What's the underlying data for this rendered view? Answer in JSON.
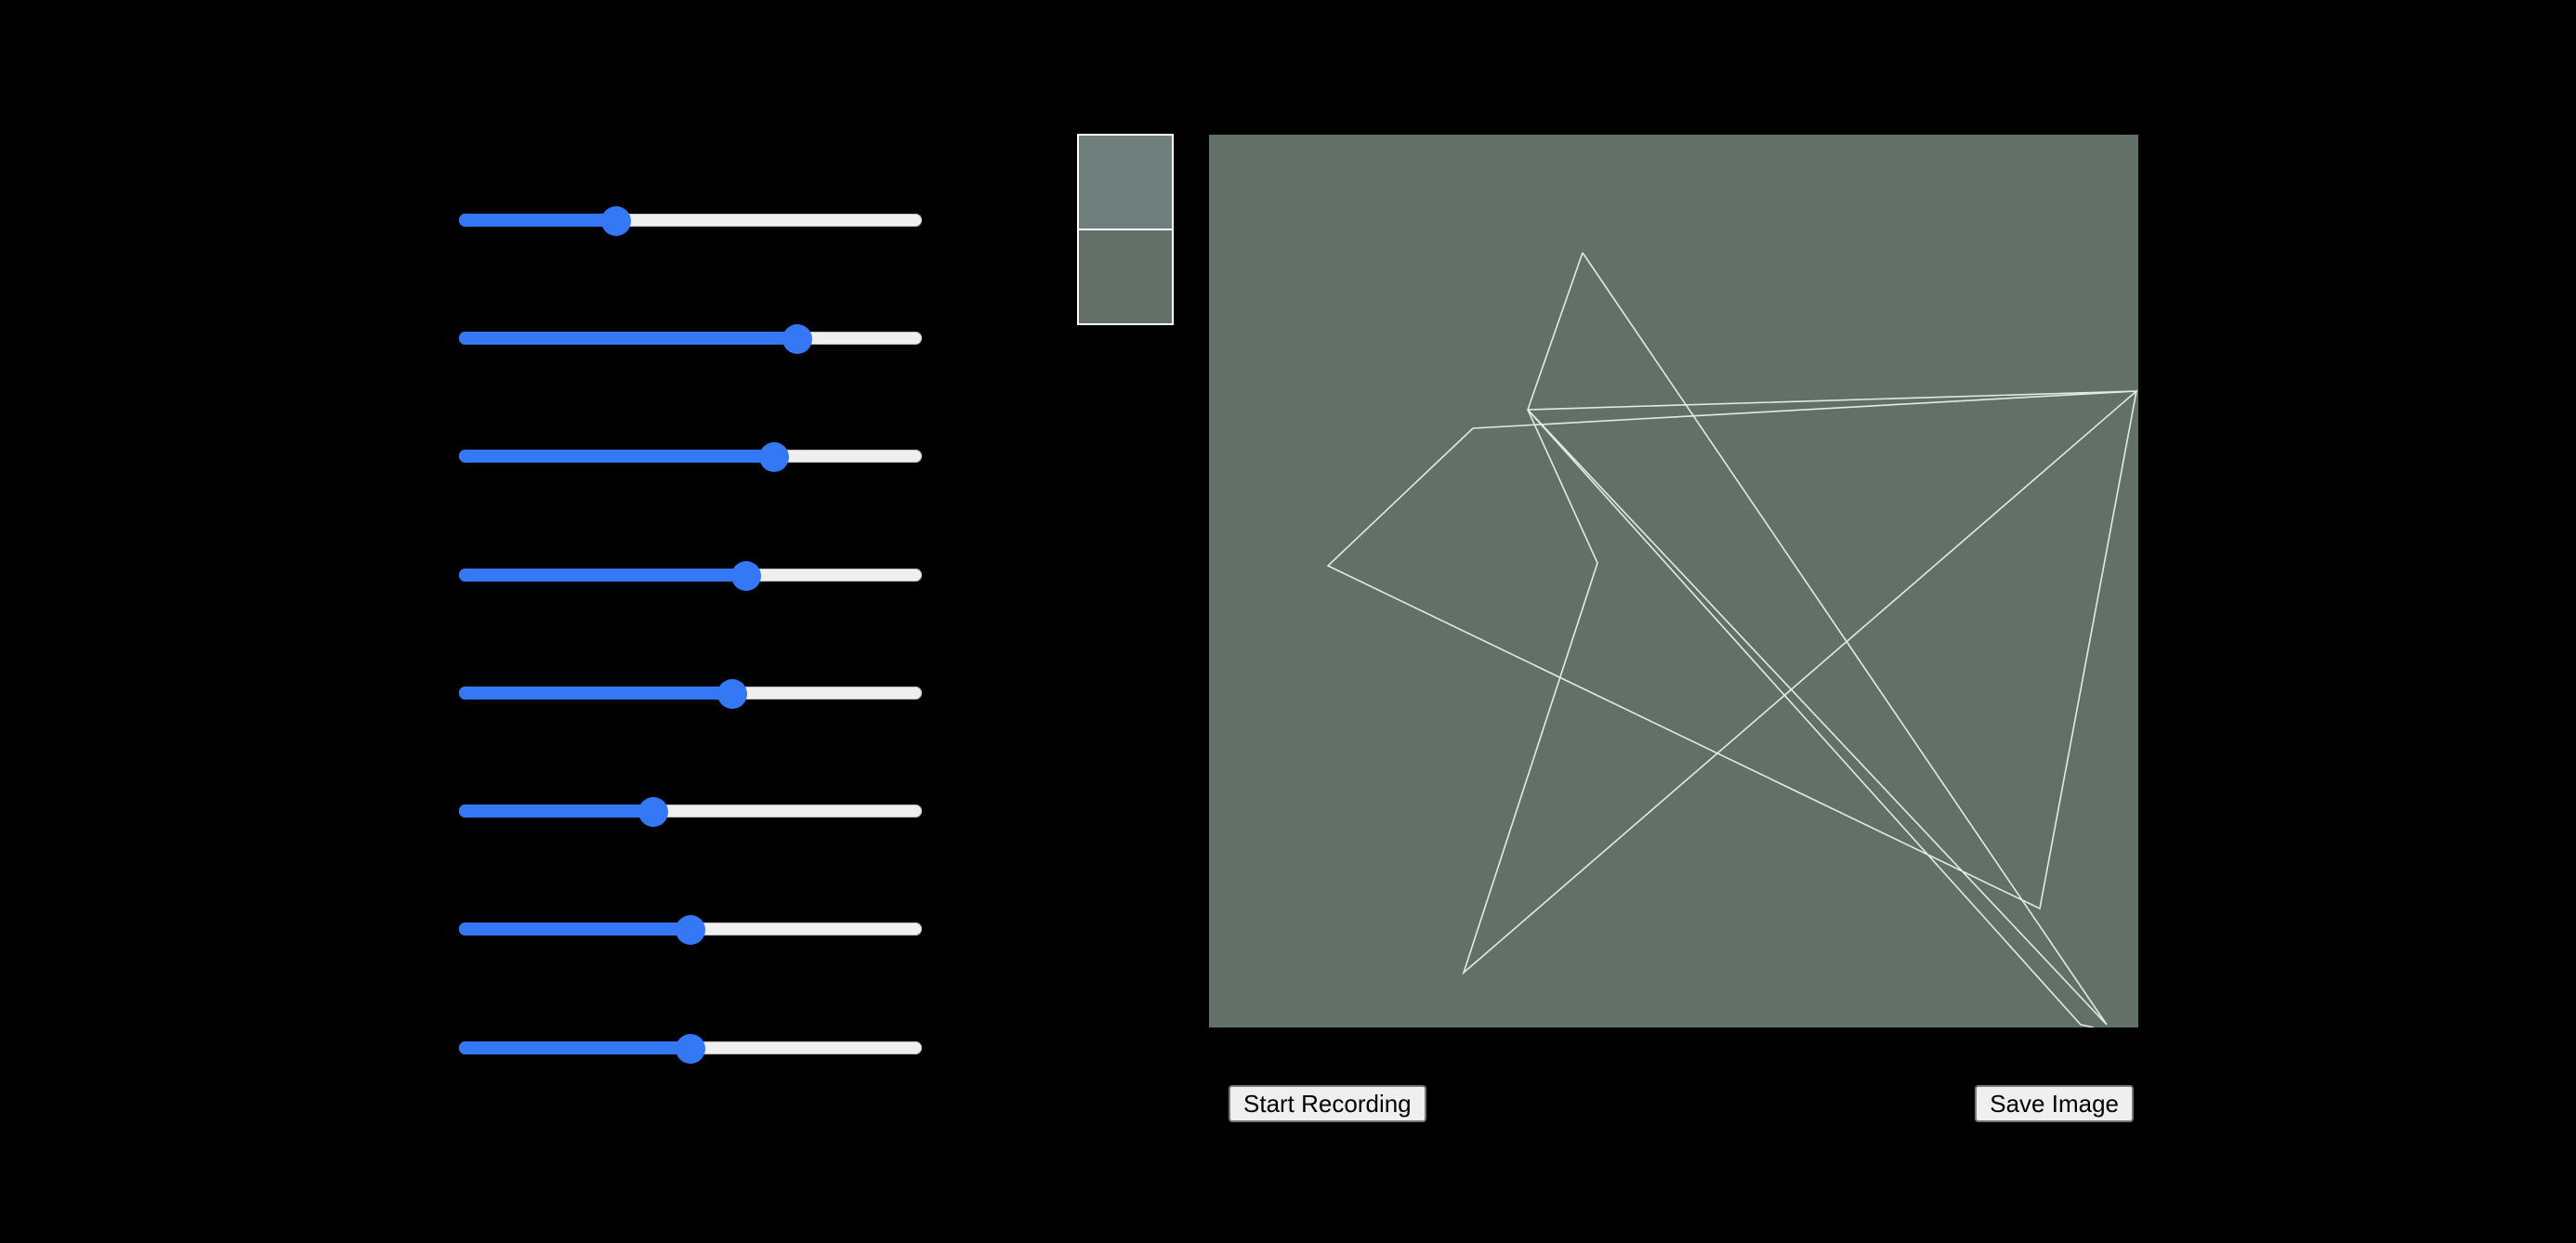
{
  "colors": {
    "background": "#000000",
    "slider_accent": "#3478f6",
    "slider_track": "#efefef",
    "canvas_background": "#637067",
    "swatch_top": "#6f7f7c",
    "swatch_bottom": "#637067",
    "stroke": "#e3ebe4"
  },
  "sliders": [
    {
      "value": 0.34
    },
    {
      "value": 0.73
    },
    {
      "value": 0.68
    },
    {
      "value": 0.62
    },
    {
      "value": 0.59
    },
    {
      "value": 0.42
    },
    {
      "value": 0.5
    },
    {
      "value": 0.5
    }
  ],
  "buttons": {
    "start_recording": "Start Recording",
    "save_image": "Save Image"
  }
}
